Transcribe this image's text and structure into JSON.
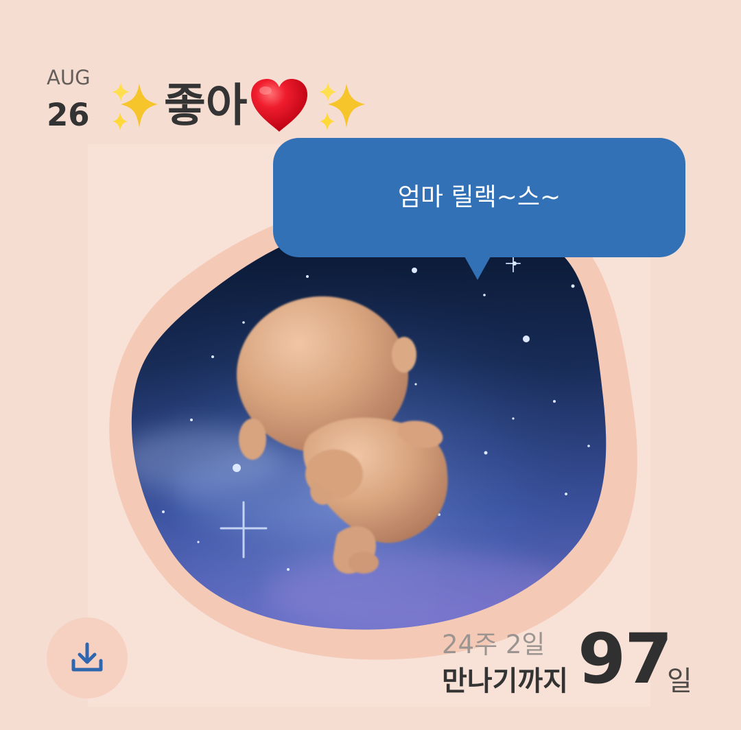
{
  "header": {
    "month": "AUG",
    "day": "26",
    "title": "좋아",
    "emoji_left": "sparkles",
    "emoji_heart": "heart",
    "emoji_right": "sparkles"
  },
  "speech_bubble": {
    "text": "엄마 릴랙~스~"
  },
  "illustration": {
    "subject": "baby illustration in starry womb"
  },
  "footer": {
    "weeks_text": "24주 2일",
    "until_label": "만나기까지",
    "days_remaining": "97",
    "days_unit": "일",
    "download_icon": "download-icon"
  },
  "colors": {
    "background": "#f6ddd2",
    "bubble": "#3371b6",
    "accent_blue": "#2e67b0",
    "button_bg": "#f6d1c1"
  }
}
